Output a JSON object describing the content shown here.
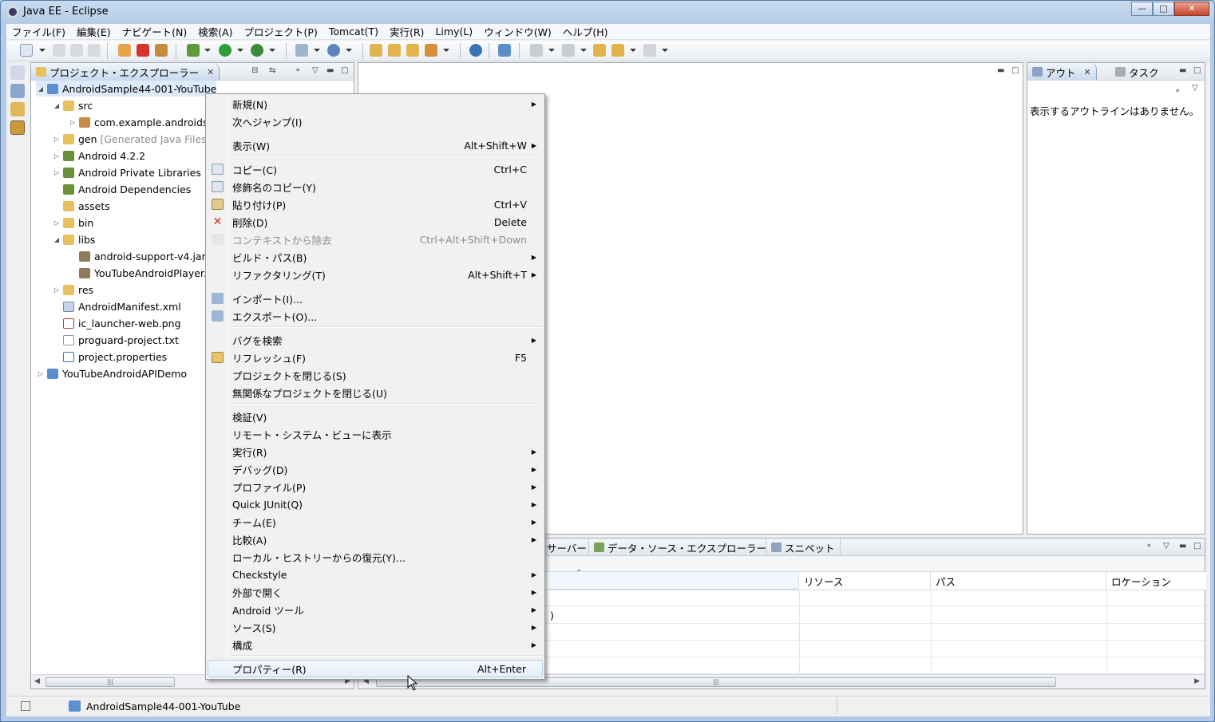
{
  "window": {
    "title": "Java EE - Eclipse"
  },
  "menubar": [
    "ファイル(F)",
    "編集(E)",
    "ナビゲート(N)",
    "検索(A)",
    "プロジェクト(P)",
    "Tomcat(T)",
    "実行(R)",
    "Limy(L)",
    "ウィンドウ(W)",
    "ヘルプ(H)"
  ],
  "explorer": {
    "tab_label": "プロジェクト・エクスプローラー",
    "nodes": [
      {
        "label": "AndroidSample44-001-YouTube",
        "suffix": ""
      },
      {
        "label": "src",
        "suffix": ""
      },
      {
        "label": "com.example.androidsa",
        "suffix": ""
      },
      {
        "label": "gen",
        "suffix": "[Generated Java Files]"
      },
      {
        "label": "Android 4.2.2",
        "suffix": ""
      },
      {
        "label": "Android Private Libraries",
        "suffix": ""
      },
      {
        "label": "Android Dependencies",
        "suffix": ""
      },
      {
        "label": "assets",
        "suffix": ""
      },
      {
        "label": "bin",
        "suffix": ""
      },
      {
        "label": "libs",
        "suffix": ""
      },
      {
        "label": "android-support-v4.jar",
        "suffix": ""
      },
      {
        "label": "YouTubeAndroidPlayerA",
        "suffix": ""
      },
      {
        "label": "res",
        "suffix": ""
      },
      {
        "label": "AndroidManifest.xml",
        "suffix": ""
      },
      {
        "label": "ic_launcher-web.png",
        "suffix": ""
      },
      {
        "label": "proguard-project.txt",
        "suffix": ""
      },
      {
        "label": "project.properties",
        "suffix": ""
      },
      {
        "label": "YouTubeAndroidAPIDemo",
        "suffix": ""
      }
    ]
  },
  "outline": {
    "tab_outline": "アウト",
    "tab_tasks": "タスク",
    "empty_text": "表示するアウトラインはありません。"
  },
  "bottom": {
    "tabs": [
      "サーバー",
      "データ・ソース・エクスプローラー",
      "スニペット"
    ],
    "columns": [
      "リソース",
      "パス",
      "ロケーション"
    ],
    "row_fragment": ")"
  },
  "context_menu": [
    {
      "label": "新規(N)",
      "shortcut": "",
      "submenu": true
    },
    {
      "label": "次へジャンプ(I)",
      "shortcut": "",
      "submenu": false
    },
    {
      "label": "表示(W)",
      "shortcut": "Alt+Shift+W",
      "submenu": true
    },
    {
      "label": "コピー(C)",
      "shortcut": "Ctrl+C",
      "submenu": false
    },
    {
      "label": "修飾名のコピー(Y)",
      "shortcut": "",
      "submenu": false
    },
    {
      "label": "貼り付け(P)",
      "shortcut": "Ctrl+V",
      "submenu": false
    },
    {
      "label": "削除(D)",
      "shortcut": "Delete",
      "submenu": false
    },
    {
      "label": "コンテキストから除去",
      "shortcut": "Ctrl+Alt+Shift+Down",
      "submenu": false
    },
    {
      "label": "ビルド・パス(B)",
      "shortcut": "",
      "submenu": true
    },
    {
      "label": "リファクタリング(T)",
      "shortcut": "Alt+Shift+T",
      "submenu": true
    },
    {
      "label": "インポート(I)...",
      "shortcut": "",
      "submenu": false
    },
    {
      "label": "エクスポート(O)...",
      "shortcut": "",
      "submenu": false
    },
    {
      "label": "バグを検索",
      "shortcut": "",
      "submenu": true
    },
    {
      "label": "リフレッシュ(F)",
      "shortcut": "F5",
      "submenu": false
    },
    {
      "label": "プロジェクトを閉じる(S)",
      "shortcut": "",
      "submenu": false
    },
    {
      "label": "無関係なプロジェクトを閉じる(U)",
      "shortcut": "",
      "submenu": false
    },
    {
      "label": "検証(V)",
      "shortcut": "",
      "submenu": false
    },
    {
      "label": "リモート・システム・ビューに表示",
      "shortcut": "",
      "submenu": false
    },
    {
      "label": "実行(R)",
      "shortcut": "",
      "submenu": true
    },
    {
      "label": "デバッグ(D)",
      "shortcut": "",
      "submenu": true
    },
    {
      "label": "プロファイル(P)",
      "shortcut": "",
      "submenu": true
    },
    {
      "label": "Quick JUnit(Q)",
      "shortcut": "",
      "submenu": true
    },
    {
      "label": "チーム(E)",
      "shortcut": "",
      "submenu": true
    },
    {
      "label": "比較(A)",
      "shortcut": "",
      "submenu": true
    },
    {
      "label": "ローカル・ヒストリーからの復元(Y)...",
      "shortcut": "",
      "submenu": false
    },
    {
      "label": "Checkstyle",
      "shortcut": "",
      "submenu": true
    },
    {
      "label": "外部で開く",
      "shortcut": "",
      "submenu": true
    },
    {
      "label": "Android ツール",
      "shortcut": "",
      "submenu": true
    },
    {
      "label": "ソース(S)",
      "shortcut": "",
      "submenu": true
    },
    {
      "label": "構成",
      "shortcut": "",
      "submenu": true
    },
    {
      "label": "プロパティー(R)",
      "shortcut": "Alt+Enter",
      "submenu": false
    }
  ],
  "status": {
    "selected": "AndroidSample44-001-YouTube"
  },
  "glyphs": {
    "minimize": "▭",
    "maximize": "□",
    "close": "✕",
    "tab_close": "✕",
    "expanded": "◢",
    "collapsed": "▷",
    "submenu": "▶",
    "scroll_left": "◀",
    "scroll_right": "▶",
    "grip": "|||",
    "sort": "⌃",
    "view_menu": "▽"
  }
}
